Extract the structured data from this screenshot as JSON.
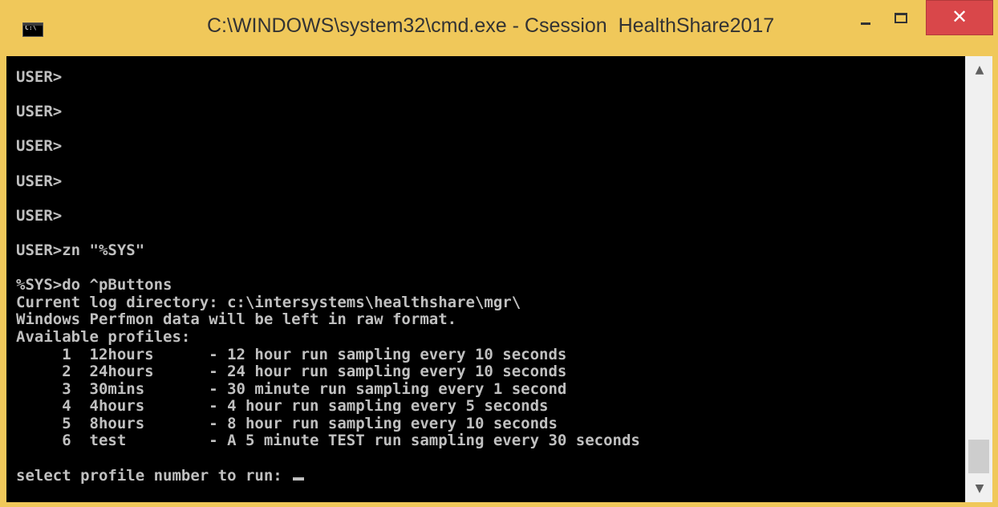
{
  "window": {
    "title": "C:\\WINDOWS\\system32\\cmd.exe - Csession  HealthShare2017",
    "icon": "cmd-icon"
  },
  "controls": {
    "minimize": "–",
    "maximize": "□",
    "close": "✕"
  },
  "scrollbar": {
    "up_arrow": "▲",
    "down_arrow": "▼"
  },
  "console": {
    "lines": [
      "USER>",
      "",
      "USER>",
      "",
      "USER>",
      "",
      "USER>",
      "",
      "USER>",
      "",
      "USER>zn \"%SYS\"",
      "",
      "%SYS>do ^pButtons",
      "Current log directory: c:\\intersystems\\healthshare\\mgr\\",
      "Windows Perfmon data will be left in raw format.",
      "Available profiles:",
      "     1  12hours      - 12 hour run sampling every 10 seconds",
      "     2  24hours      - 24 hour run sampling every 10 seconds",
      "     3  30mins       - 30 minute run sampling every 1 second",
      "     4  4hours       - 4 hour run sampling every 5 seconds",
      "     5  8hours       - 8 hour run sampling every 10 seconds",
      "     6  test         - A 5 minute TEST run sampling every 30 seconds",
      "",
      "select profile number to run: "
    ]
  }
}
